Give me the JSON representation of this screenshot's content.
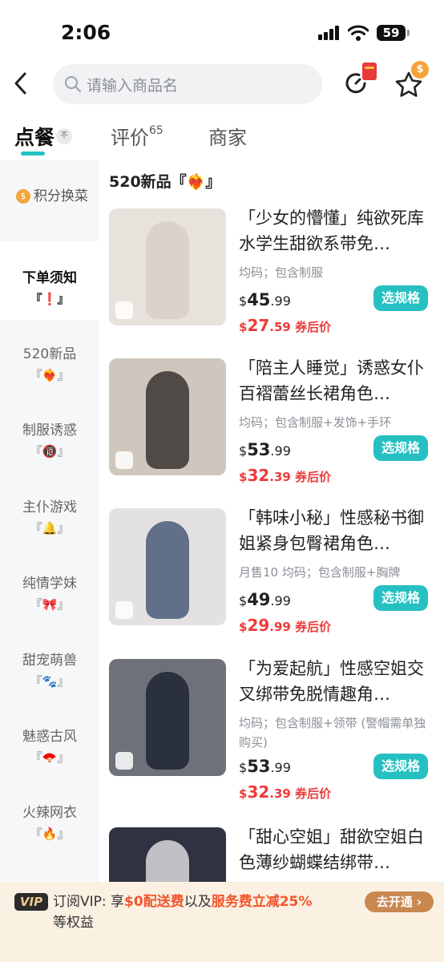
{
  "status": {
    "time": "2:06",
    "battery": "59"
  },
  "header": {
    "search_placeholder": "请输入商品名"
  },
  "tabs": [
    {
      "label": "点餐"
    },
    {
      "label": "评价",
      "count": "65"
    },
    {
      "label": "商家"
    }
  ],
  "sort_badge": "不",
  "sidebar": {
    "points_label": "积分换菜",
    "points_icon": "$",
    "items": [
      {
        "label": "下单须知",
        "emoji": "『❗』"
      },
      {
        "label": "520新品",
        "emoji": "『❤️‍🔥』"
      },
      {
        "label": "制服诱惑",
        "emoji": "『🔞』"
      },
      {
        "label": "主仆游戏",
        "emoji": "『🔔』"
      },
      {
        "label": "纯情学妹",
        "emoji": "『🎀』"
      },
      {
        "label": "甜宠萌兽",
        "emoji": "『🐾』"
      },
      {
        "label": "魅惑古风",
        "emoji": "『🪭』"
      },
      {
        "label": "火辣网衣",
        "emoji": "『🔥』"
      }
    ]
  },
  "section_title": "520新品『❤️‍🔥』",
  "products": [
    {
      "name": "「少女的懵懂」纯欲死库水学生甜欲系带免…",
      "spec": "均码；包含制服",
      "price_int": "45",
      "price_dec": ".99",
      "coupon_int": "27",
      "coupon_dec": ".59",
      "coupon_label": "券后价",
      "button": "选规格",
      "color": "#d8cfc7"
    },
    {
      "name": "「陪主人睡觉」诱惑女仆百褶蕾丝长裙角色…",
      "spec": "均码；包含制服+发饰+手环",
      "price_int": "53",
      "price_dec": ".99",
      "coupon_int": "32",
      "coupon_dec": ".39",
      "coupon_label": "券后价",
      "button": "选规格",
      "color": "#b9ada0"
    },
    {
      "name": "「韩味小秘」性感秘书御姐紧身包臀裙角色…",
      "spec": "月售10 均码；包含制服+胸牌",
      "price_int": "49",
      "price_dec": ".99",
      "coupon_int": "29",
      "coupon_dec": ".99",
      "coupon_label": "券后价",
      "button": "选规格",
      "color": "#c7ccd6"
    },
    {
      "name": "「为爱起航」性感空姐交叉绑带免脱情趣角…",
      "spec": "均码；包含制服+领带 (警帽需单独购买)",
      "price_int": "53",
      "price_dec": ".99",
      "coupon_int": "32",
      "coupon_dec": ".39",
      "coupon_label": "券后价",
      "button": "选规格",
      "color": "#7d7f88"
    },
    {
      "name": "「甜心空姐」甜欲空姐白色薄纱蝴蝶结绑带…",
      "spec": "",
      "price_int": "",
      "price_dec": "",
      "coupon_int": "",
      "coupon_dec": "",
      "coupon_label": "",
      "button": "",
      "color": "#3e4150"
    }
  ],
  "vip": {
    "badge": "VIP",
    "text_1": "订阅VIP: 享",
    "hl_1": "$0配送费",
    "text_2": "以及",
    "hl_2": "服务费立减25%",
    "text_3": "等权益",
    "button": "去开通 ›"
  },
  "colors": {
    "accent": "#26c0c2",
    "price_red": "#ee3a3a",
    "vip_bg": "#fbf1e3"
  }
}
